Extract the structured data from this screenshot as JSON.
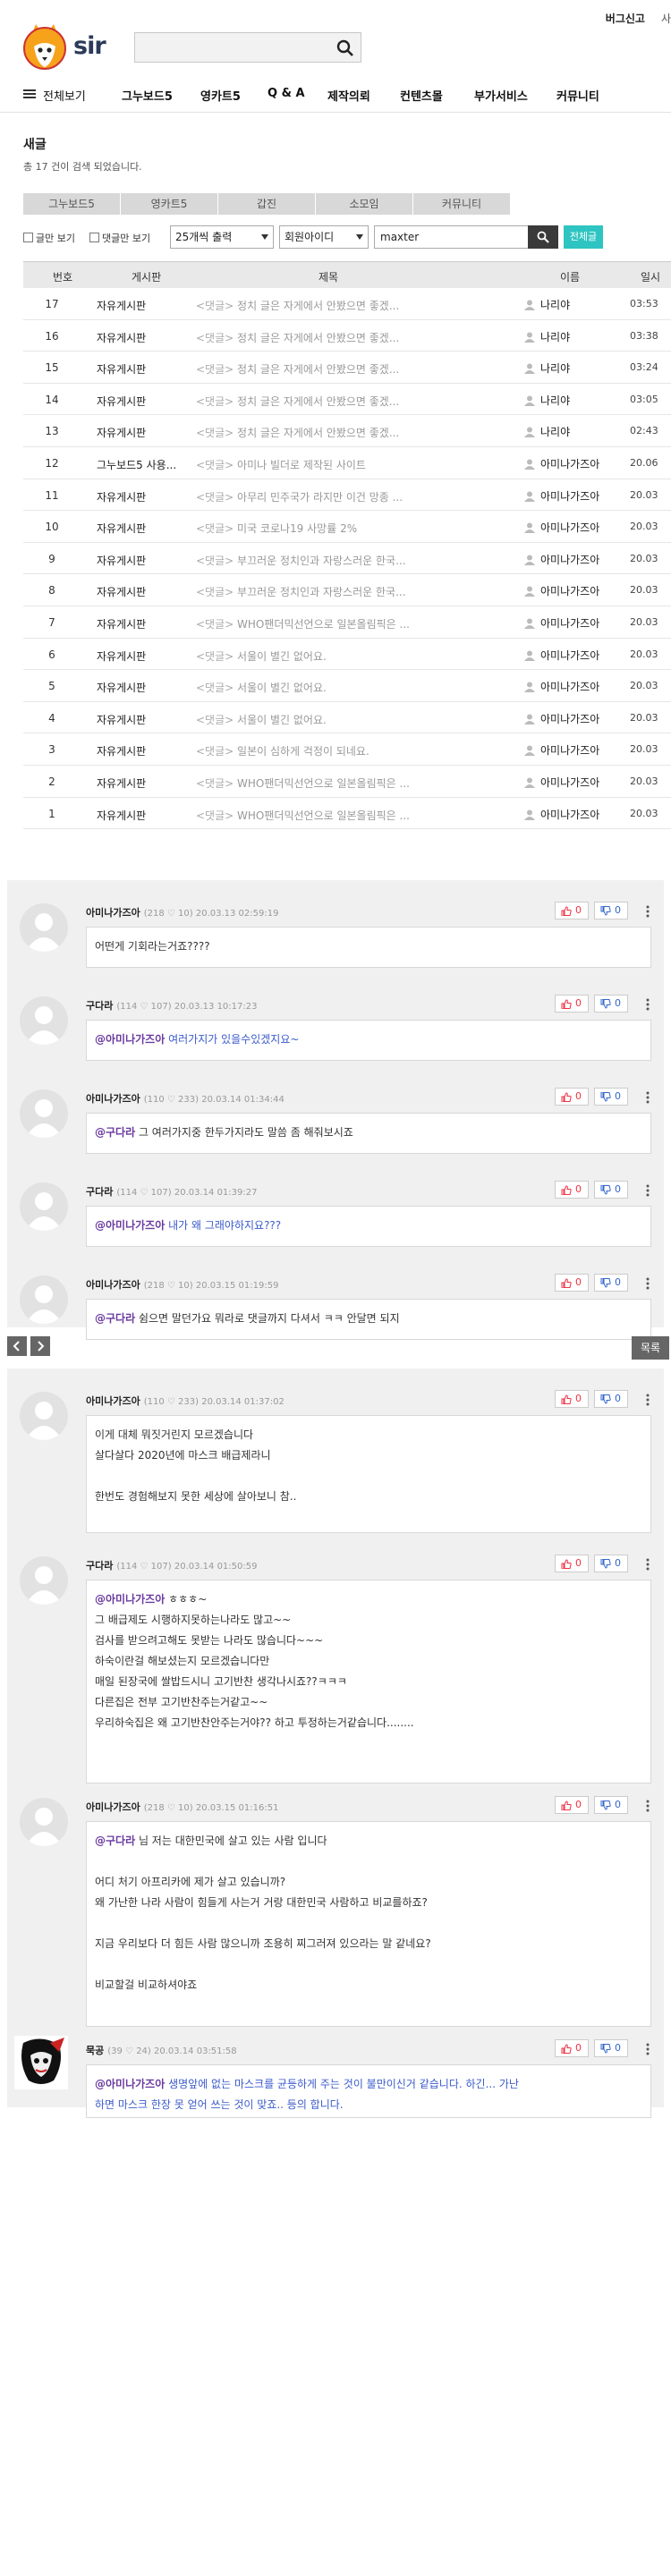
{
  "header": {
    "logo_text": "sir",
    "search": {
      "value": "",
      "placeholder": ""
    },
    "top_links": [
      "버그신고",
      "사"
    ]
  },
  "nav": {
    "items": [
      "전체보기",
      "그누보드5",
      "영카트5",
      "Q & A",
      "제작의뢰",
      "컨텐츠몰",
      "부가서비스",
      "커뮤니티"
    ]
  },
  "board": {
    "title": "새글",
    "count_text": "총 17 건이 검색 되었습니다.",
    "tabs": [
      "그누보드5",
      "영카트5",
      "갑진",
      "소모임",
      "커뮤니티"
    ],
    "filter": {
      "check_text_only": "글만 보기",
      "check_comment_only": "댓글만 보기",
      "per_page": "25개씩 출력",
      "search_field": "회원아이디",
      "query": "maxter",
      "all_button": "전체글"
    },
    "columns": [
      "번호",
      "게시판",
      "제목",
      "이름",
      "일시"
    ],
    "rows": [
      {
        "no": "17",
        "board": "자유게시판",
        "tag": "<댓글>",
        "subject": "정치 글은 자게에서 안봤으면 좋겠...",
        "author": "나리야",
        "time": "03:53"
      },
      {
        "no": "16",
        "board": "자유게시판",
        "tag": "<댓글>",
        "subject": "정치 글은 자게에서 안봤으면 좋겠...",
        "author": "나리야",
        "time": "03:38"
      },
      {
        "no": "15",
        "board": "자유게시판",
        "tag": "<댓글>",
        "subject": "정치 글은 자게에서 안봤으면 좋겠...",
        "author": "나리야",
        "time": "03:24"
      },
      {
        "no": "14",
        "board": "자유게시판",
        "tag": "<댓글>",
        "subject": "정치 글은 자게에서 안봤으면 좋겠...",
        "author": "나리야",
        "time": "03:05"
      },
      {
        "no": "13",
        "board": "자유게시판",
        "tag": "<댓글>",
        "subject": "정치 글은 자게에서 안봤으면 좋겠...",
        "author": "나리야",
        "time": "02:43"
      },
      {
        "no": "12",
        "board": "그누보드5 사용...",
        "tag": "<댓글>",
        "subject": "아미나 빌더로 제작된 사이트",
        "author": "아미나가즈아",
        "time": "20.06"
      },
      {
        "no": "11",
        "board": "자유게시판",
        "tag": "<댓글>",
        "subject": "아무리 민주국가 라지만 이건 망종 ...",
        "author": "아미나가즈아",
        "time": "20.03"
      },
      {
        "no": "10",
        "board": "자유게시판",
        "tag": "<댓글>",
        "subject": "미국 코로나19 사망률 2%",
        "author": "아미나가즈아",
        "time": "20.03"
      },
      {
        "no": "9",
        "board": "자유게시판",
        "tag": "<댓글>",
        "subject": "부끄러운 정치인과 자랑스러운 한국...",
        "author": "아미나가즈아",
        "time": "20.03"
      },
      {
        "no": "8",
        "board": "자유게시판",
        "tag": "<댓글>",
        "subject": "부끄러운 정치인과 자랑스러운 한국...",
        "author": "아미나가즈아",
        "time": "20.03"
      },
      {
        "no": "7",
        "board": "자유게시판",
        "tag": "<댓글>",
        "subject": "WHO팬더믹선언으로 일본올림픽은 ...",
        "author": "아미나가즈아",
        "time": "20.03"
      },
      {
        "no": "6",
        "board": "자유게시판",
        "tag": "<댓글>",
        "subject": "서울이 별긴 없어요.",
        "author": "아미나가즈아",
        "time": "20.03"
      },
      {
        "no": "5",
        "board": "자유게시판",
        "tag": "<댓글>",
        "subject": "서울이 별긴 없어요.",
        "author": "아미나가즈아",
        "time": "20.03"
      },
      {
        "no": "4",
        "board": "자유게시판",
        "tag": "<댓글>",
        "subject": "서울이 별긴 없어요.",
        "author": "아미나가즈아",
        "time": "20.03"
      },
      {
        "no": "3",
        "board": "자유게시판",
        "tag": "<댓글>",
        "subject": "일본이 심하게 걱정이 되네요.",
        "author": "아미나가즈아",
        "time": "20.03"
      },
      {
        "no": "2",
        "board": "자유게시판",
        "tag": "<댓글>",
        "subject": "WHO팬더믹선언으로 일본올림픽은 ...",
        "author": "아미나가즈아",
        "time": "20.03"
      },
      {
        "no": "1",
        "board": "자유게시판",
        "tag": "<댓글>",
        "subject": "WHO팬더믹선언으로 일본올림픽은 ...",
        "author": "아미나가즈아",
        "time": "20.03"
      }
    ]
  },
  "comments_a": [
    {
      "name": "아미나가즈아",
      "meta": "(218 ♡ 10) 20.03.13 02:59:19",
      "up": "0",
      "down": "0",
      "lines": [
        "어떤게 기회라는거죠????"
      ]
    },
    {
      "name": "구다라",
      "meta": "(114 ♡ 107) 20.03.13 10:17:23",
      "up": "0",
      "down": "0",
      "mention": "@아미나가즈아",
      "lines": [
        "여러가지가 있을수있겠지요~"
      ]
    },
    {
      "name": "아미나가즈아",
      "meta": "(110 ♡ 233) 20.03.14 01:34:44",
      "up": "0",
      "down": "0",
      "mention": "@구다라",
      "lines": [
        "그 여러가지중 한두가지라도 말씀 좀 해줘보시죠"
      ]
    },
    {
      "name": "구다라",
      "meta": "(114 ♡ 107) 20.03.14 01:39:27",
      "up": "0",
      "down": "0",
      "mention": "@아미나가즈아",
      "lines": [
        "내가 왜 그래야하지요???"
      ]
    },
    {
      "name": "아미나가즈아",
      "meta": "(218 ♡ 10) 20.03.15 01:19:59",
      "up": "0",
      "down": "0",
      "mention": "@구다라",
      "lines": [
        "쉼으면 말던가요 뭐라로 댓글까지 다셔서 ㅋㅋ 안달면 되지"
      ]
    }
  ],
  "list_button": "목록",
  "comments_b": [
    {
      "name": "아미나가즈아",
      "meta": "(110 ♡ 233) 20.03.14 01:37:02",
      "up": "0",
      "down": "0",
      "lines": [
        "이게 대체 뭐짓거린지 모르겠습니다",
        "살다살다 2020년에 마스크 배급제라니",
        "",
        "한번도 경험해보지 못한 세상에 살아보니 참.."
      ]
    },
    {
      "name": "구다라",
      "meta": "(114 ♡ 107) 20.03.14 01:50:59",
      "up": "0",
      "down": "0",
      "mention": "@아미나가즈아",
      "lines": [
        "ㅎㅎㅎ~",
        "그 배급제도 시행하지못하는나라도 많고~~",
        "검사를 받으려고해도 못받는 나라도 많습니다~~~",
        "하숙이란걸 해보셨는지 모르겠습니다만",
        "매일 된장국에 쌀밥드시니 고기반찬 생각나시죠??ㅋㅋㅋ",
        "다른집은 전부 고기반찬주는거같고~~",
        "우리하숙집은 왜 고기반찬안주는거야?? 하고 투정하는거같습니다........"
      ]
    },
    {
      "name": "아미나가즈아",
      "meta": "(218 ♡ 10) 20.03.15 01:16:51",
      "up": "0",
      "down": "0",
      "mention": "@구다라",
      "lines": [
        "님 저는 대한민국에 살고 있는 사람 입니다",
        "",
        "어디 처기 아프리카에 제가 살고 있습니까?",
        "왜 가난한 나라 사람이 힘들게 사는거 거랑 대한민국 사람하고 비교를하죠?",
        "",
        "지금 우리보다 더 힘든 사람 많으니까 조용히 찌그러져 있으라는 말 같네요?",
        "",
        "비교할걸 비교하셔야죠"
      ]
    },
    {
      "name": "묵공",
      "meta": "(39 ♡ 24) 20.03.14 03:51:58",
      "up": "0",
      "down": "0",
      "mention": "@아미나가즈아",
      "lines": [
        "생명앞에 없는 마스크를 균등하게 주는 것이 불만이신거 같습니다. 하긴... 가난",
        "하면 마스크 한장 못 얻어 쓰는 것이 맞죠.. 등의 합니다."
      ]
    }
  ]
}
